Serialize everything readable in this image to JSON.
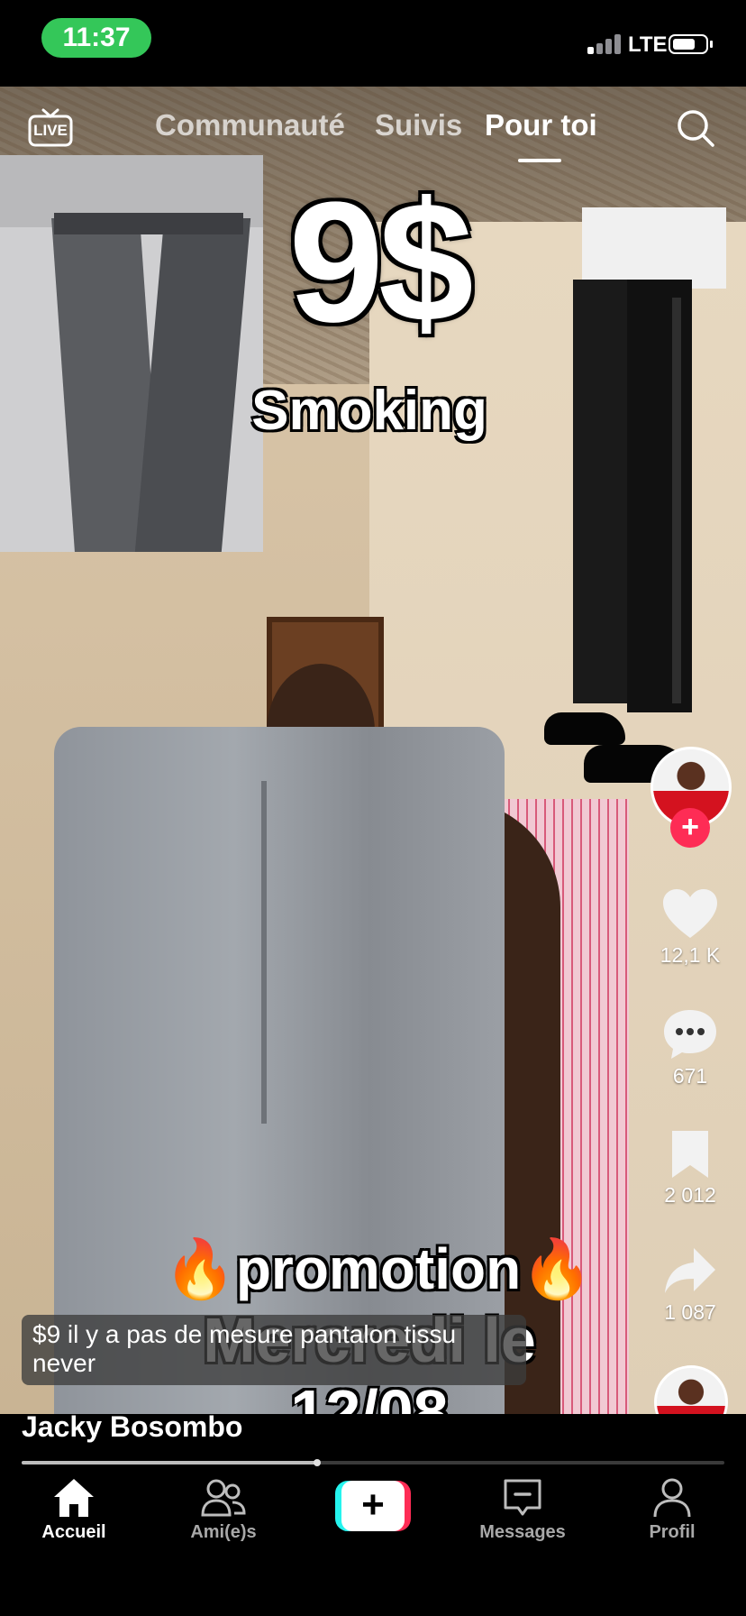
{
  "status_bar": {
    "time": "11:37",
    "network": "LTE"
  },
  "top_nav": {
    "live_label": "LIVE",
    "tabs": [
      {
        "label": "Communauté"
      },
      {
        "label": "Suivis"
      },
      {
        "label": "Pour toi",
        "active": true
      }
    ]
  },
  "video_overlay": {
    "price": "9$",
    "subtitle": "Smoking",
    "promo": "promotion",
    "date": "Mercredi le 12/08"
  },
  "actions": {
    "likes": "12,1 K",
    "comments": "671",
    "saves": "2 012",
    "shares": "1 087"
  },
  "caption": {
    "text": "$9 il y a pas de mesure pantalon tissu never"
  },
  "author": {
    "name": "Jacky Bosombo"
  },
  "playback": {
    "progress": 0.42
  },
  "bottom_nav": {
    "items": [
      {
        "label": "Accueil",
        "icon": "home-icon",
        "active": true
      },
      {
        "label": "Ami(e)s",
        "icon": "friends-icon"
      },
      {
        "label": "",
        "icon": "create-icon"
      },
      {
        "label": "Messages",
        "icon": "inbox-icon"
      },
      {
        "label": "Profil",
        "icon": "profile-icon"
      }
    ]
  },
  "colors": {
    "status_green": "#34c759",
    "brand_red": "#fe2c55",
    "brand_cyan": "#25f4ee"
  }
}
